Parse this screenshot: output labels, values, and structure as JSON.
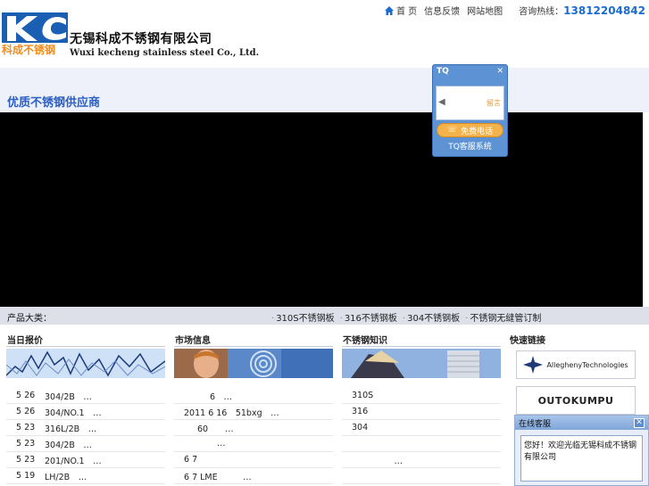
{
  "header": {
    "company_cn": "无锡科成不锈钢有限公司",
    "company_en": "Wuxi kecheng stainless steel Co., Ltd.",
    "logo_text": "科成不锈钢",
    "nav": {
      "home": "首 页",
      "feedback": "信息反馈",
      "sitemap": "网站地图",
      "hotline_label": "咨询热线：",
      "hotline_number": "13812204842"
    }
  },
  "banner": {
    "slogan": "优质不锈钢供应商"
  },
  "ticker": {
    "label": "产品大类：",
    "items": [
      "310S不锈钢板",
      "316不锈钢板",
      "304不锈钢板",
      "不锈钢无缝管订制"
    ]
  },
  "columns": [
    {
      "title": "当日报价",
      "rows": [
        {
          "date": "5 26",
          "text": "304/2B　…"
        },
        {
          "date": "5 26",
          "text": "304/NO.1　…"
        },
        {
          "date": "5 23",
          "text": "316L/2B　…"
        },
        {
          "date": "5 23",
          "text": "304/2B　…"
        },
        {
          "date": "5 23",
          "text": "201/NO.1　…"
        },
        {
          "date": "5 19",
          "text": "LH/2B　…"
        }
      ]
    },
    {
      "title": "市场信息",
      "rows": [
        {
          "text": "6　…"
        },
        {
          "text": "2011 6 16　51bxg　…"
        },
        {
          "text": "60　　…"
        },
        {
          "text": "…"
        },
        {
          "text": "6 7"
        },
        {
          "text": "6 7 LME　　　…"
        }
      ]
    },
    {
      "title": "不锈钢知识",
      "rows": [
        {
          "text": "310S"
        },
        {
          "text": "316"
        },
        {
          "text": "304"
        },
        {
          "text": ""
        },
        {
          "text": "　　　　　…"
        },
        {
          "text": ""
        }
      ]
    }
  ],
  "quick_links": {
    "title": "快速链接",
    "items": [
      "AlleghenyTechnologies",
      "OUTOKUMPU"
    ]
  },
  "tq_widget": {
    "title": "TQ",
    "call_button": "免费电话",
    "footer": "TQ客服系统",
    "status": "留言"
  },
  "chat_popup": {
    "title": "在线客服",
    "message": "您好！欢迎光临无锡科成不锈钢有限公司"
  },
  "colors": {
    "accent": "#2a5fc4",
    "hotline": "#1b6ccf",
    "logo_blue": "#1a5fb4",
    "logo_orange": "#f28c1b"
  }
}
